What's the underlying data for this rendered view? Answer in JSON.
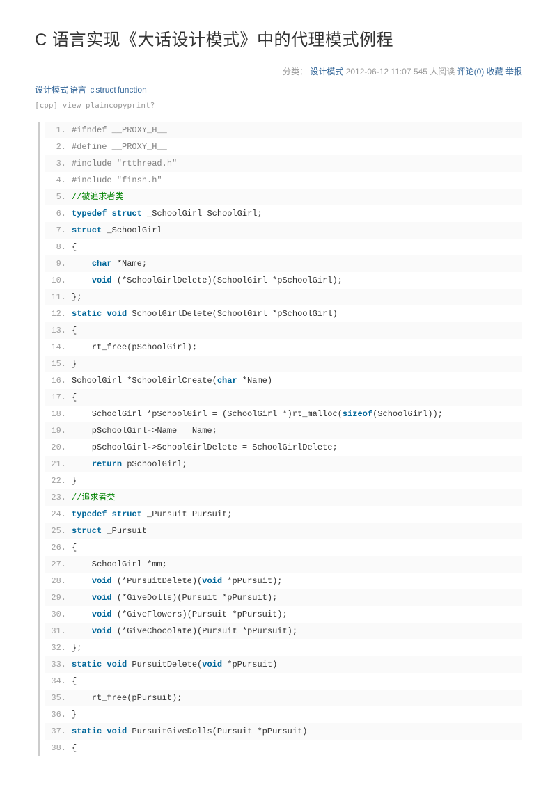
{
  "title": "C 语言实现《大话设计模式》中的代理模式例程",
  "meta": {
    "category_label": "分类：",
    "category_link": "设计模式",
    "datetime": "2012-06-12 11:07",
    "reads_num": "545",
    "reads_label": "人阅读",
    "comments_label": "评论(0)",
    "favorite_label": "收藏",
    "report_label": "举报"
  },
  "tags": [
    "设计模式",
    "语言",
    "c",
    "struct",
    "function"
  ],
  "toolbar": {
    "lang": "[cpp]",
    "view": "view plain",
    "copy": "copy",
    "print": "print",
    "q": "?"
  },
  "code": [
    {
      "t": "pre",
      "txt": "#ifndef __PROXY_H__"
    },
    {
      "t": "pre",
      "txt": "#define __PROXY_H__"
    },
    {
      "t": "pre",
      "txt": "#include \"rtthread.h\""
    },
    {
      "t": "pre",
      "txt": "#include \"finsh.h\""
    },
    {
      "t": "cmt",
      "txt": "//被追求者类"
    },
    {
      "t": "plain",
      "html": "<span class=\"kw\">typedef</span> <span class=\"kw\">struct</span> _SchoolGirl SchoolGirl;"
    },
    {
      "t": "plain",
      "html": "<span class=\"kw\">struct</span> _SchoolGirl"
    },
    {
      "t": "plain",
      "txt": "{"
    },
    {
      "t": "plain",
      "html": "    <span class=\"kw\">char</span> *Name;"
    },
    {
      "t": "plain",
      "html": "    <span class=\"kw\">void</span> (*SchoolGirlDelete)(SchoolGirl *pSchoolGirl);"
    },
    {
      "t": "plain",
      "txt": "};"
    },
    {
      "t": "plain",
      "html": "<span class=\"kw\">static</span> <span class=\"kw\">void</span> SchoolGirlDelete(SchoolGirl *pSchoolGirl)"
    },
    {
      "t": "plain",
      "txt": "{"
    },
    {
      "t": "plain",
      "txt": "    rt_free(pSchoolGirl);"
    },
    {
      "t": "plain",
      "txt": "}"
    },
    {
      "t": "plain",
      "html": "SchoolGirl *SchoolGirlCreate(<span class=\"kw\">char</span> *Name)"
    },
    {
      "t": "plain",
      "txt": "{"
    },
    {
      "t": "plain",
      "html": "    SchoolGirl *pSchoolGirl = (SchoolGirl *)rt_malloc(<span class=\"kw\">sizeof</span>(SchoolGirl));"
    },
    {
      "t": "plain",
      "txt": "    pSchoolGirl->Name = Name;"
    },
    {
      "t": "plain",
      "txt": "    pSchoolGirl->SchoolGirlDelete = SchoolGirlDelete;"
    },
    {
      "t": "plain",
      "html": "    <span class=\"kw\">return</span> pSchoolGirl;"
    },
    {
      "t": "plain",
      "txt": "}"
    },
    {
      "t": "cmt",
      "txt": "//追求者类"
    },
    {
      "t": "plain",
      "html": "<span class=\"kw\">typedef</span> <span class=\"kw\">struct</span> _Pursuit Pursuit;"
    },
    {
      "t": "plain",
      "html": "<span class=\"kw\">struct</span> _Pursuit"
    },
    {
      "t": "plain",
      "txt": "{"
    },
    {
      "t": "plain",
      "txt": "    SchoolGirl *mm;"
    },
    {
      "t": "plain",
      "html": "    <span class=\"kw\">void</span> (*PursuitDelete)(<span class=\"kw\">void</span> *pPursuit);"
    },
    {
      "t": "plain",
      "html": "    <span class=\"kw\">void</span> (*GiveDolls)(Pursuit *pPursuit);"
    },
    {
      "t": "plain",
      "html": "    <span class=\"kw\">void</span> (*GiveFlowers)(Pursuit *pPursuit);"
    },
    {
      "t": "plain",
      "html": "    <span class=\"kw\">void</span> (*GiveChocolate)(Pursuit *pPursuit);"
    },
    {
      "t": "plain",
      "txt": "};"
    },
    {
      "t": "plain",
      "html": "<span class=\"kw\">static</span> <span class=\"kw\">void</span> PursuitDelete(<span class=\"kw\">void</span> *pPursuit)"
    },
    {
      "t": "plain",
      "txt": "{"
    },
    {
      "t": "plain",
      "txt": "    rt_free(pPursuit);"
    },
    {
      "t": "plain",
      "txt": "}"
    },
    {
      "t": "plain",
      "html": "<span class=\"kw\">static</span> <span class=\"kw\">void</span> PursuitGiveDolls(Pursuit *pPursuit)"
    },
    {
      "t": "plain",
      "txt": "{"
    }
  ]
}
